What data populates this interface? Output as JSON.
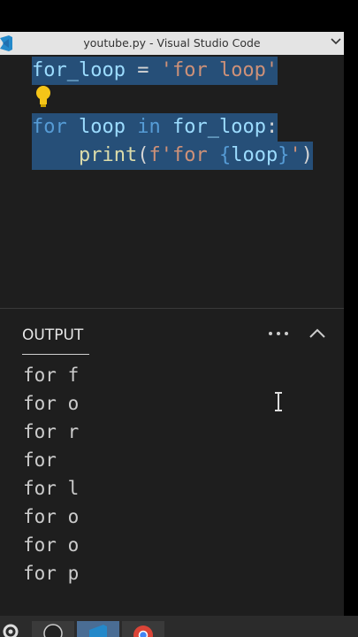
{
  "window": {
    "title": "youtube.py - Visual Studio Code"
  },
  "editor": {
    "line1": {
      "var": "for_loop",
      "op": " = ",
      "str": "'for loop'"
    },
    "line2": {
      "kw1": "for",
      "var1": " loop ",
      "kw2": "in",
      "var2": " for_loop",
      "op": ":"
    },
    "line3": {
      "indent": "    ",
      "fn": "print",
      "p1": "(",
      "s1": "f'for ",
      "b1": "{",
      "var": "loop",
      "b2": "}",
      "s2": "'",
      "p2": ")"
    }
  },
  "output": {
    "tab_label": "OUTPUT",
    "lines": [
      "for f",
      "for o",
      "for r",
      "for",
      "for l",
      "for o",
      "for o",
      "for p"
    ]
  },
  "colors": {
    "selection": "#264f78",
    "keyword": "#569cd6",
    "variable": "#9cdcfe",
    "string": "#ce9178",
    "function": "#dcdcaa"
  }
}
